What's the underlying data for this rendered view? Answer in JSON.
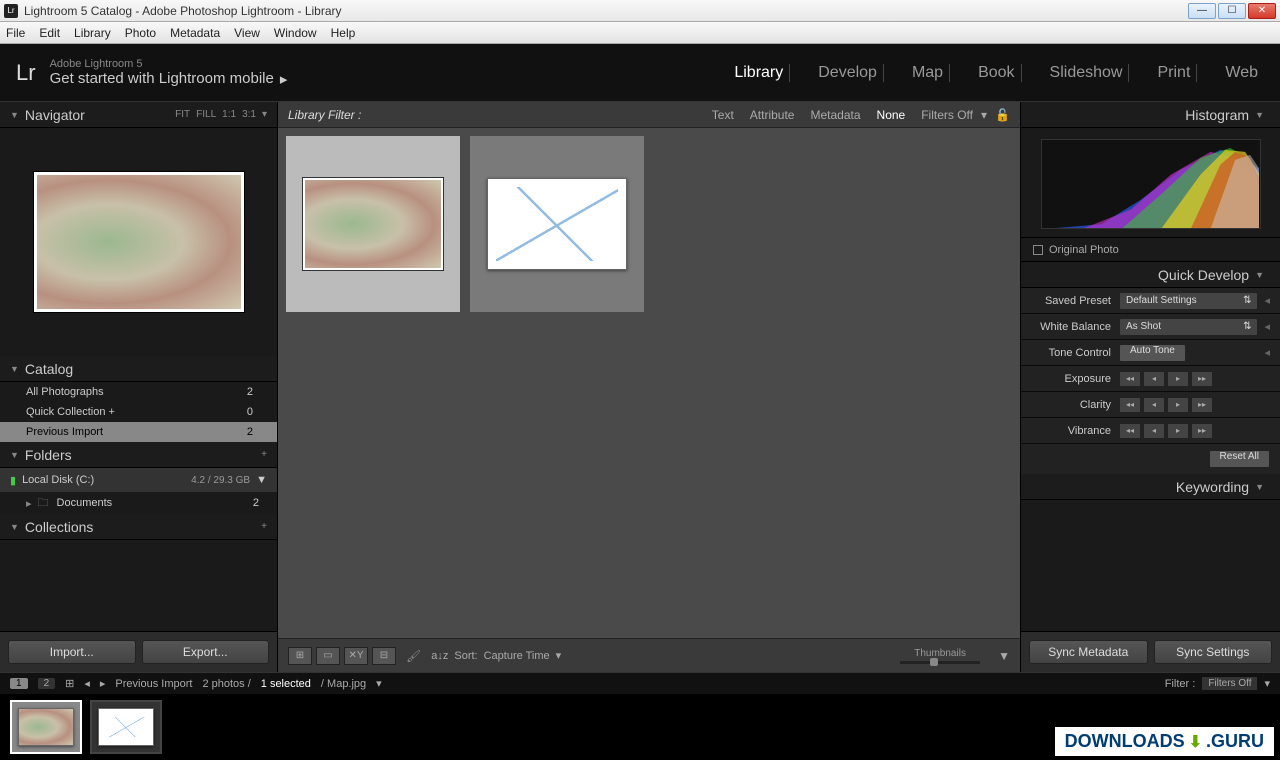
{
  "window": {
    "title": "Lightroom 5 Catalog - Adobe Photoshop Lightroom - Library",
    "app_icon": "Lr"
  },
  "menubar": [
    "File",
    "Edit",
    "Library",
    "Photo",
    "Metadata",
    "View",
    "Window",
    "Help"
  ],
  "header": {
    "logo": "Lr",
    "subtitle_small": "Adobe Lightroom 5",
    "subtitle_big": "Get started with Lightroom mobile"
  },
  "modules": [
    {
      "label": "Library",
      "active": true
    },
    {
      "label": "Develop",
      "active": false
    },
    {
      "label": "Map",
      "active": false
    },
    {
      "label": "Book",
      "active": false
    },
    {
      "label": "Slideshow",
      "active": false
    },
    {
      "label": "Print",
      "active": false
    },
    {
      "label": "Web",
      "active": false
    }
  ],
  "navigator": {
    "title": "Navigator",
    "opts": [
      "FIT",
      "FILL",
      "1:1",
      "3:1"
    ]
  },
  "catalog": {
    "title": "Catalog",
    "items": [
      {
        "label": "All Photographs",
        "count": 2,
        "selected": false
      },
      {
        "label": "Quick Collection  +",
        "count": 0,
        "selected": false
      },
      {
        "label": "Previous Import",
        "count": 2,
        "selected": true
      }
    ]
  },
  "folders": {
    "title": "Folders",
    "volume": {
      "name": "Local Disk (C:)",
      "size": "4.2 / 29.3 GB"
    },
    "items": [
      {
        "label": "Documents",
        "count": 2
      }
    ]
  },
  "collections": {
    "title": "Collections"
  },
  "left_buttons": {
    "import": "Import...",
    "export": "Export..."
  },
  "filter_bar": {
    "label": "Library Filter :",
    "tabs": [
      {
        "label": "Text",
        "active": false
      },
      {
        "label": "Attribute",
        "active": false
      },
      {
        "label": "Metadata",
        "active": false
      },
      {
        "label": "None",
        "active": true
      }
    ],
    "right_label": "Filters Off"
  },
  "center_toolbar": {
    "sort_label": "Sort:",
    "sort_value": "Capture Time",
    "thumb_label": "Thumbnails"
  },
  "right": {
    "histogram": "Histogram",
    "original_photo": "Original Photo",
    "quick_develop": "Quick Develop",
    "saved_preset_label": "Saved Preset",
    "saved_preset_value": "Default Settings",
    "white_balance_label": "White Balance",
    "white_balance_value": "As Shot",
    "tone_control_label": "Tone Control",
    "auto_tone": "Auto Tone",
    "exposure": "Exposure",
    "clarity": "Clarity",
    "vibrance": "Vibrance",
    "reset": "Reset All",
    "keywording": "Keywording",
    "sync_meta": "Sync Metadata",
    "sync_settings": "Sync Settings"
  },
  "statusbar": {
    "pages": [
      "1",
      "2"
    ],
    "source": "Previous Import",
    "count": "2 photos /",
    "selected": "1 selected",
    "file": "/ Map.jpg",
    "filter_label": "Filter :",
    "filter_value": "Filters Off"
  },
  "watermark": {
    "text1": "DOWNLOADS",
    "text2": ".GURU"
  }
}
